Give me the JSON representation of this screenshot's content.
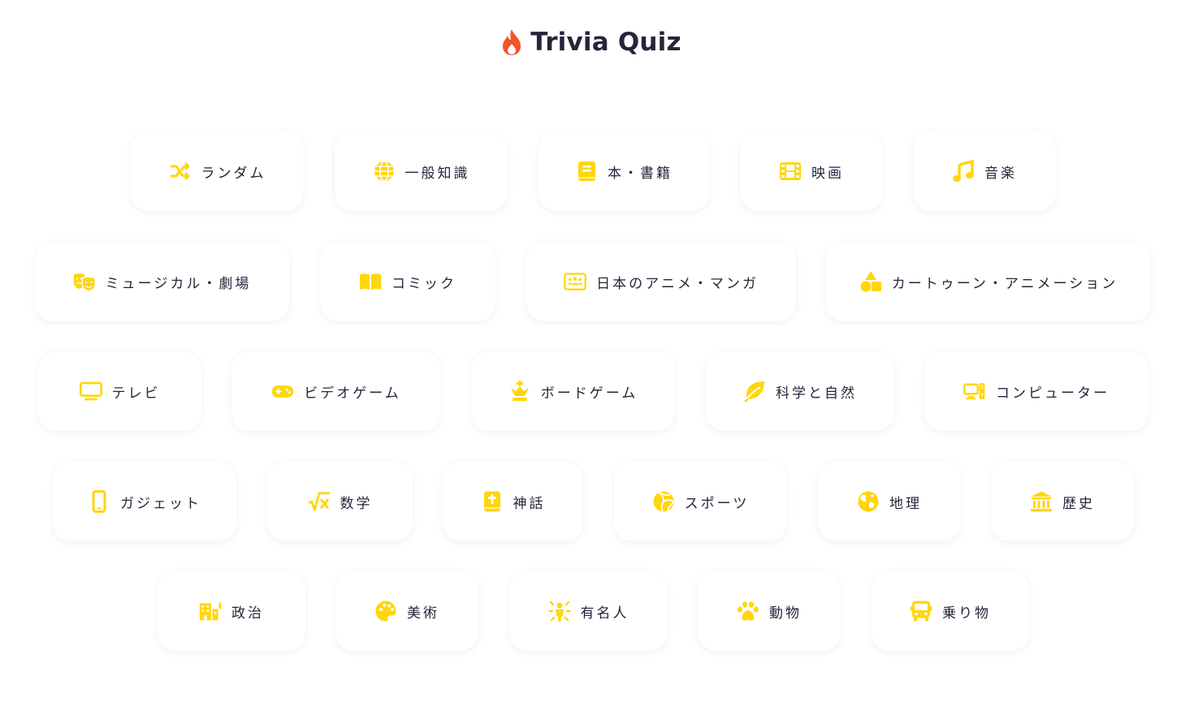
{
  "app": {
    "title": "Trivia Quiz",
    "accent_color": "#FFD60A",
    "flame_color": "#F2542D"
  },
  "categories": [
    {
      "label": "ランダム",
      "icon": "shuffle-icon"
    },
    {
      "label": "一般知識",
      "icon": "globe-icon"
    },
    {
      "label": "本・書籍",
      "icon": "book-icon"
    },
    {
      "label": "映画",
      "icon": "film-icon"
    },
    {
      "label": "音楽",
      "icon": "music-note-icon"
    },
    {
      "label": "ミュージカル・劇場",
      "icon": "theater-masks-icon"
    },
    {
      "label": "コミック",
      "icon": "open-book-icon"
    },
    {
      "label": "日本のアニメ・マンガ",
      "icon": "screen-users-icon"
    },
    {
      "label": "カートゥーン・アニメーション",
      "icon": "shapes-icon"
    },
    {
      "label": "テレビ",
      "icon": "tv-icon"
    },
    {
      "label": "ビデオゲーム",
      "icon": "gamepad-icon"
    },
    {
      "label": "ボードゲーム",
      "icon": "chess-king-icon"
    },
    {
      "label": "科学と自然",
      "icon": "leaf-icon"
    },
    {
      "label": "コンピューター",
      "icon": "desktop-computer-icon"
    },
    {
      "label": "ガジェット",
      "icon": "mobile-phone-icon"
    },
    {
      "label": "数学",
      "icon": "square-root-icon"
    },
    {
      "label": "神話",
      "icon": "bible-icon"
    },
    {
      "label": "スポーツ",
      "icon": "volleyball-icon"
    },
    {
      "label": "地理",
      "icon": "earth-icon"
    },
    {
      "label": "歴史",
      "icon": "landmark-icon"
    },
    {
      "label": "政治",
      "icon": "city-icon"
    },
    {
      "label": "美術",
      "icon": "palette-icon"
    },
    {
      "label": "有名人",
      "icon": "celebrity-icon"
    },
    {
      "label": "動物",
      "icon": "paw-icon"
    },
    {
      "label": "乗り物",
      "icon": "bus-icon"
    }
  ]
}
